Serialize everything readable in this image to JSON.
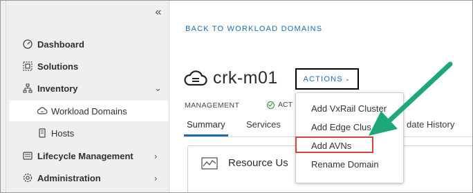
{
  "sidebar": {
    "collapse_icon": "double-chevron-left-icon",
    "items": [
      {
        "label": "Dashboard",
        "icon": "gauge-icon"
      },
      {
        "label": "Solutions",
        "icon": "solutions-icon"
      },
      {
        "label": "Inventory",
        "icon": "inventory-icon"
      },
      {
        "label": "Workload Domains",
        "icon": "cloud-icon"
      },
      {
        "label": "Hosts",
        "icon": "host-icon"
      },
      {
        "label": "Lifecycle Management",
        "icon": "lifecycle-icon"
      },
      {
        "label": "Administration",
        "icon": "gear-icon"
      }
    ]
  },
  "main": {
    "back_link": "BACK TO WORKLOAD DOMAINS",
    "title": "crk-m01",
    "actions_label": "ACTIONS",
    "type_label": "MANAGEMENT",
    "status_label": "ACT",
    "tabs": [
      {
        "label": "Summary"
      },
      {
        "label": "Services"
      },
      {
        "label": "date History"
      }
    ],
    "card_title": "Resource Us"
  },
  "dropdown": {
    "items": [
      {
        "label": "Add VxRail Cluster"
      },
      {
        "label": "Add Edge Clus"
      },
      {
        "label": "Add AVNs"
      },
      {
        "label": "Rename Domain"
      }
    ]
  },
  "colors": {
    "accent": "#1a6db0",
    "highlight": "#d9433b",
    "arrow": "#1fa67a"
  }
}
